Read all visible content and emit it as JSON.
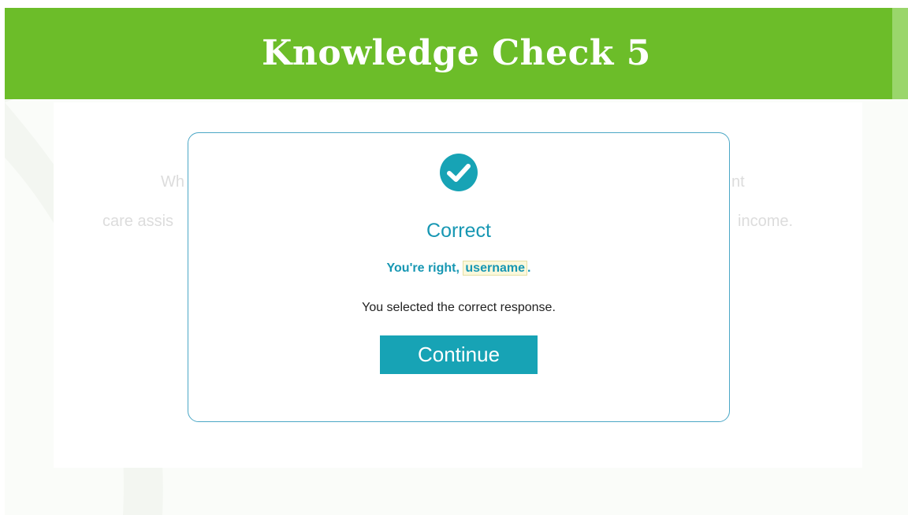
{
  "header": {
    "title": "Knowledge Check 5"
  },
  "question": {
    "line1_left": "Wh",
    "line1_right": "nt",
    "line2_left": "care assis",
    "line2_right": "income."
  },
  "modal": {
    "icon": "check-circle-icon",
    "title": "Correct",
    "feedback_prefix": "You're right, ",
    "username": "username",
    "feedback_suffix": ".",
    "message": "You selected the correct response.",
    "continue_label": "Continue"
  },
  "colors": {
    "header_green": "#6cbd29",
    "accent_teal": "#17a3b5",
    "modal_border": "#4ba7c6"
  }
}
